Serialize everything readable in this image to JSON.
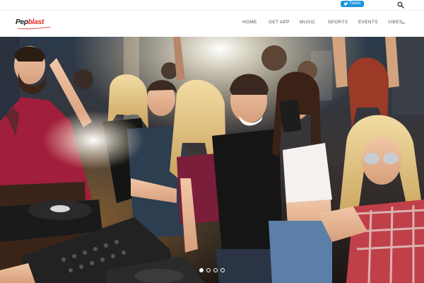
{
  "topbar": {
    "tweet_label": "Tweet"
  },
  "brand": {
    "logo_part1": "Pep",
    "logo_part2": "blast",
    "accent_color": "#e2231a"
  },
  "nav": {
    "items": [
      {
        "label": "HOME"
      },
      {
        "label": "GET APP"
      },
      {
        "label": "MUSIC"
      },
      {
        "label": "SPORTS"
      },
      {
        "label": "EVENTS"
      },
      {
        "label": "VIBES"
      }
    ]
  },
  "slider": {
    "slide_count": 4,
    "active_index": 0
  },
  "icons": {
    "search": "search-icon",
    "tweet": "twitter-bird-icon",
    "dropdown": "chevron-down-icon"
  }
}
